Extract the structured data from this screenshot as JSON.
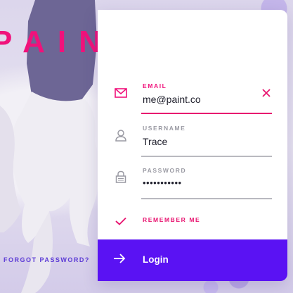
{
  "brand": {
    "name": "PAINT.CO"
  },
  "links": {
    "forgot_password": "FORGOT PASSWORD?"
  },
  "form": {
    "email": {
      "label": "EMAIL",
      "value": "me@paint.co",
      "icon": "mail-icon"
    },
    "username": {
      "label": "USERNAME",
      "value": "Trace",
      "icon": "user-icon"
    },
    "password": {
      "label": "PASSWORD",
      "value": "•••••••••••",
      "icon": "lock-icon"
    },
    "remember": {
      "label": "REMEMBER ME",
      "checked": true
    },
    "login_label": "Login"
  },
  "colors": {
    "accent_pink": "#f0127b",
    "button_purple": "#5a12f3",
    "link_purple": "#5c3bd6",
    "muted_gray": "#9a9aa3"
  }
}
